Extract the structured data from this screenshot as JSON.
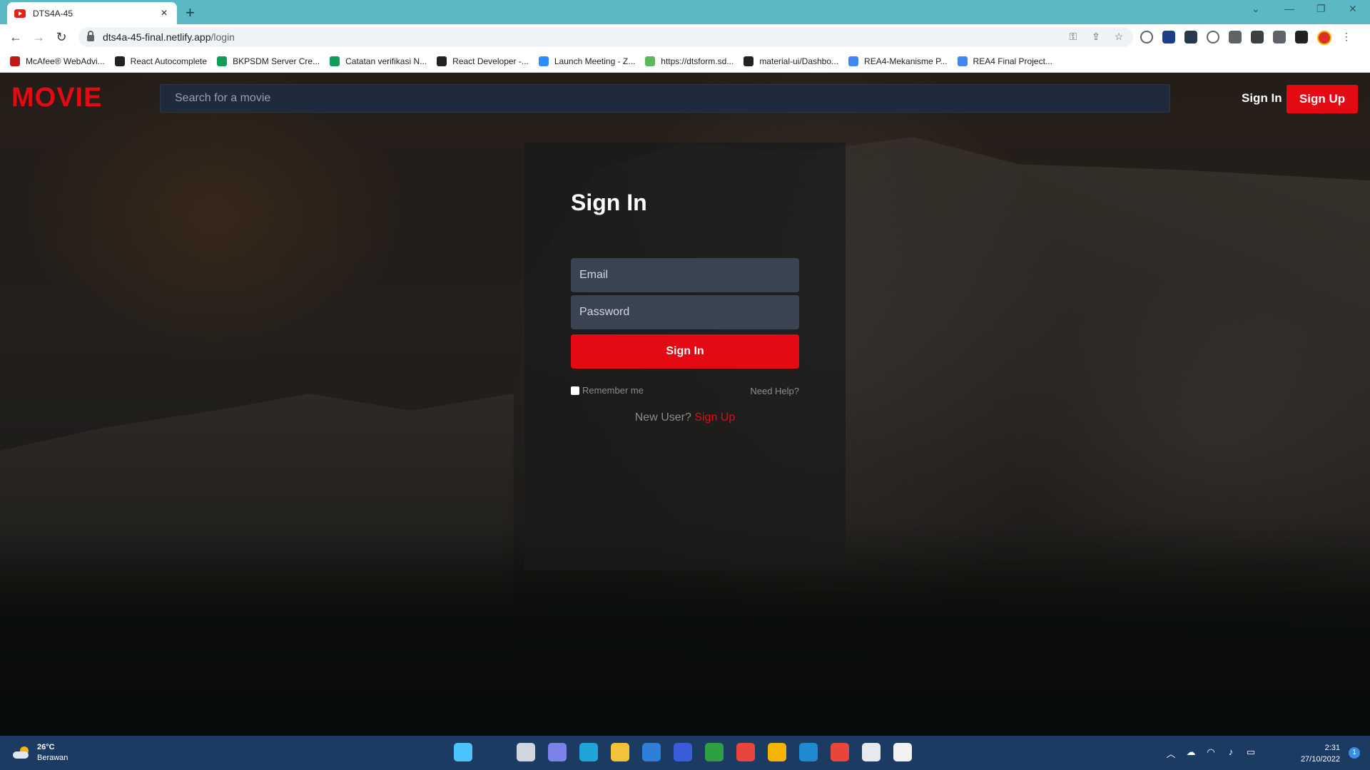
{
  "browser": {
    "tab_title": "DTS4A-45",
    "url_host": "dts4a-45-final.netlify.app",
    "url_path": "/login",
    "bookmarks": [
      {
        "label": "McAfee® WebAdvi...",
        "color": "#c01818"
      },
      {
        "label": "React Autocomplete",
        "color": "#222222"
      },
      {
        "label": "BKPSDM Server Cre...",
        "color": "#0f9d58"
      },
      {
        "label": "Catatan verifikasi N...",
        "color": "#0f9d58"
      },
      {
        "label": "React Developer -...",
        "color": "#222222"
      },
      {
        "label": "Launch Meeting - Z...",
        "color": "#2d8cff"
      },
      {
        "label": "https://dtsform.sd...",
        "color": "#5cb85c"
      },
      {
        "label": "material-ui/Dashbo...",
        "color": "#222222"
      },
      {
        "label": "REA4-Mekanisme P...",
        "color": "#4285f4"
      },
      {
        "label": "REA4 Final Project...",
        "color": "#4285f4"
      }
    ]
  },
  "app": {
    "logo": "MOVIE",
    "search_placeholder": "Search for a movie",
    "nav_sign_in": "Sign In",
    "nav_sign_up": "Sign Up",
    "accent_color": "#e50914"
  },
  "login": {
    "title": "Sign In",
    "email_placeholder": "Email",
    "password_placeholder": "Password",
    "submit_label": "Sign In",
    "remember_label": "Remember me",
    "help_label": "Need Help?",
    "new_user_text": "New User?",
    "sign_up_link": "Sign Up"
  },
  "taskbar": {
    "temperature": "26°C",
    "condition": "Berawan",
    "time": "2:31",
    "date": "27/10/2022",
    "notifications": "1",
    "apps": [
      {
        "name": "windows-start-icon",
        "color": "#4cc2ff"
      },
      {
        "name": "search-icon",
        "color": "#1c3b63"
      },
      {
        "name": "task-view-icon",
        "color": "#d0d6de"
      },
      {
        "name": "chat-icon",
        "color": "#7b83eb"
      },
      {
        "name": "edge-icon",
        "color": "#1fa3d8"
      },
      {
        "name": "file-explorer-icon",
        "color": "#f3c13a"
      },
      {
        "name": "mail-icon",
        "color": "#2f7ed8"
      },
      {
        "name": "pen-app-icon",
        "color": "#3a5cd8"
      },
      {
        "name": "xbox-icon",
        "color": "#2ea043"
      },
      {
        "name": "chrome-icon",
        "color": "#e8453c"
      },
      {
        "name": "chrome-profile-icon",
        "color": "#f4b400"
      },
      {
        "name": "vscode-icon",
        "color": "#1f8ad2"
      },
      {
        "name": "video-editor-icon",
        "color": "#e8453c"
      },
      {
        "name": "store-icon",
        "color": "#e6e9ee"
      },
      {
        "name": "snipping-tool-icon",
        "color": "#f2f2f2"
      }
    ]
  }
}
